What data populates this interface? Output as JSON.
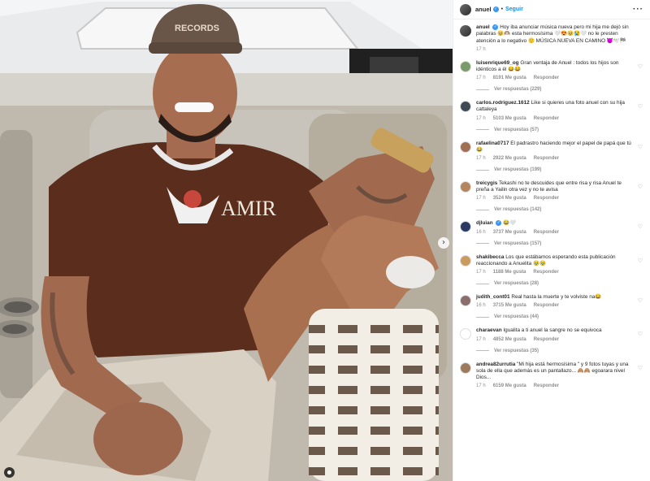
{
  "colors": {
    "link": "#0095f6",
    "verified": "#3897f0",
    "muted": "#8e8e8e"
  },
  "post": {
    "username": "anuel",
    "follow_label": "Seguir",
    "more_icon": "more-horizontal-icon",
    "carousel_icon": "chevron-right-icon",
    "tagged_icon": "user-tag-icon",
    "caption": {
      "user": "anuel",
      "text": "Hoy iba anunciar música nueva pero mi hija me dejó sin palabras 🥹🫶🏽 esta hermosísima 🤍😍🥹😭🤍 no le presten atención a lo negativo 🙂 MÚSICA NUEVA EN CAMINO 😈🕊️🏁",
      "time": "17 h"
    }
  },
  "meta_labels": {
    "reply": "Responder"
  },
  "comments": [
    {
      "user": "luisenrique69_og",
      "text": "Gran ventaja de Anuel : todos los hijos son idénticos a él 😂😂",
      "time": "17 h",
      "likes": "8191 Me gusta",
      "replies": "Ver respuestas (229)",
      "avatar": "#7a9a6b"
    },
    {
      "user": "carlos.rodriguez.1612",
      "text": "Like si quieres una foto anuel con su hija cattaleya",
      "time": "17 h",
      "likes": "5103 Me gusta",
      "replies": "Ver respuestas (57)",
      "avatar": "#3f4a57"
    },
    {
      "user": "rafaelina0717",
      "text": "El padrastro haciendo mejor el papel de papá que tú😂",
      "time": "17 h",
      "likes": "2922 Me gusta",
      "replies": "Ver respuestas (199)",
      "avatar": "#a06f53"
    },
    {
      "user": "treicygis",
      "text": "Tekashi no te descuides que entre risa y risa Anuel te preña a Yailin otra vez y no te avisa",
      "time": "17 h",
      "likes": "3524 Me gusta",
      "replies": "Ver respuestas (142)",
      "avatar": "#b3865f"
    },
    {
      "user": "djluian",
      "text": "😂🤍",
      "time": "16 h",
      "likes": "3737 Me gusta",
      "replies": "Ver respuestas (157)",
      "avatar": "#2b3a63",
      "verified": true
    },
    {
      "user": "shakibecca",
      "text": "Los que estábamos esperando esta publicación reaccionando a Anuelita 🥹🥹",
      "time": "17 h",
      "likes": "1188 Me gusta",
      "replies": "Ver respuestas (28)",
      "avatar": "#c99b5e"
    },
    {
      "user": "judith_cont01",
      "text": "Real hasta la muerte y te volviste na😂",
      "time": "16 h",
      "likes": "3715 Me gusta",
      "replies": "Ver respuestas (44)",
      "avatar": "#8a6e6a"
    },
    {
      "user": "charaevan",
      "text": "Igualita a ti anuel la sangre no se equivoca",
      "time": "17 h",
      "likes": "4852 Me gusta",
      "replies": "Ver respuestas (35)",
      "avatar": "#ffffff"
    },
    {
      "user": "andrea82urrutia",
      "text": "\"Mi hija está hermosísima \" y 9 fotos tuyas y una sola de ella que además es un pantallazo... 🙈🙈 egoarara nivel Dios...",
      "time": "17 h",
      "likes": "6159 Me gusta",
      "replies": "",
      "avatar": "#9c7b5c"
    }
  ]
}
